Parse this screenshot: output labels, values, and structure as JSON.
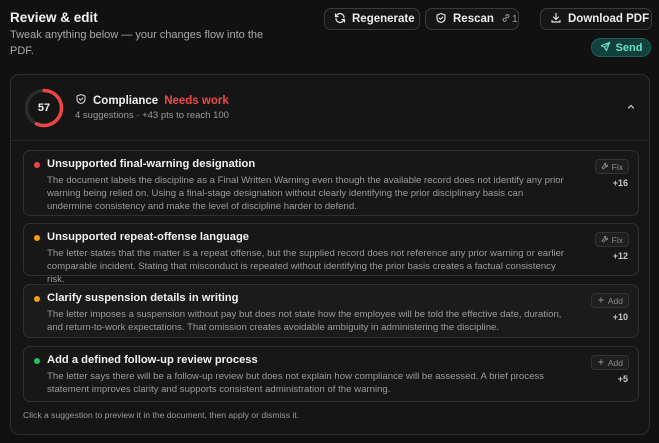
{
  "header": {
    "title": "Review & edit",
    "subtitle": "Tweak anything below — your changes flow into the PDF.",
    "regenerate_label": "Regenerate",
    "rescan_label": "Rescan",
    "rescan_count": "1",
    "download_label": "Download PDF",
    "send_label": "Send"
  },
  "compliance": {
    "score": "57",
    "score_fraction": 0.57,
    "title": "Compliance",
    "status": "Needs work",
    "summary": "4 suggestions · +43 pts to reach 100",
    "ring_color": "#ef4444"
  },
  "suggestions": [
    {
      "title": "Unsupported final-warning designation",
      "body": "The document labels the discipline as a Final Written Warning even though the available record does not identify any prior warning being relied on. Using a final-stage designation without clearly identifying the prior disciplinary basis can undermine consistency and make the level of discipline harder to defend.",
      "action": "Fix",
      "points": "+16",
      "severity_color": "#ef4444"
    },
    {
      "title": "Unsupported repeat-offense language",
      "body": "The letter states that the matter is a repeat offense, but the supplied record does not reference any prior warning or earlier comparable incident. Stating that misconduct is repeated without identifying the prior basis creates a factual consistency risk.",
      "action": "Fix",
      "points": "+12",
      "severity_color": "#f59e0b"
    },
    {
      "title": "Clarify suspension details in writing",
      "body": "The letter imposes a suspension without pay but does not state how the employee will be told the effective date, duration, and return-to-work expectations. That omission creates avoidable ambiguity in administering the discipline.",
      "action": "Add",
      "points": "+10",
      "severity_color": "#f59e0b"
    },
    {
      "title": "Add a defined follow-up review process",
      "body": "The letter says there will be a follow-up review but does not explain how compliance will be assessed. A brief process statement improves clarity and supports consistent administration of the warning.",
      "action": "Add",
      "points": "+5",
      "severity_color": "#22c55e"
    }
  ],
  "footer_note": "Click a suggestion to preview it in the document, then apply or dismiss it."
}
